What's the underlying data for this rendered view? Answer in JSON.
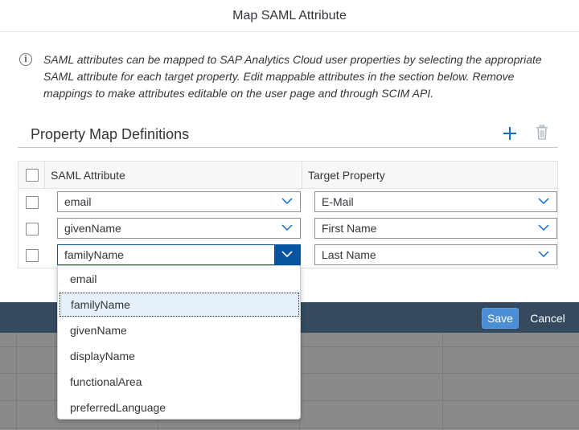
{
  "dialog": {
    "title": "Map SAML Attribute",
    "info_text": "SAML attributes can be mapped to SAP Analytics Cloud user properties by selecting the appropriate SAML attribute for each target property. Edit mappable attributes in the section below. Remove mappings to make attributes editable on the user page and through SCIM API."
  },
  "section": {
    "title": "Property Map Definitions",
    "add_icon": "add-icon",
    "delete_icon": "trash-icon"
  },
  "table": {
    "headers": [
      "SAML Attribute",
      "Target Property"
    ],
    "rows": [
      {
        "saml_attribute": "email",
        "target_property": "E-Mail"
      },
      {
        "saml_attribute": "givenName",
        "target_property": "First Name"
      },
      {
        "saml_attribute": "familyName",
        "target_property": "Last Name"
      }
    ]
  },
  "dropdown": {
    "options": [
      "email",
      "familyName",
      "givenName",
      "displayName",
      "functionalArea",
      "preferredLanguage"
    ],
    "selected": "familyName"
  },
  "footer": {
    "save_label": "Save",
    "cancel_label": "Cancel"
  },
  "colors": {
    "accent": "#0a6ed1",
    "footer_bg": "#354a5f",
    "save_bg": "#4a8fd6",
    "selected_option_bg": "#e5f0fa"
  }
}
